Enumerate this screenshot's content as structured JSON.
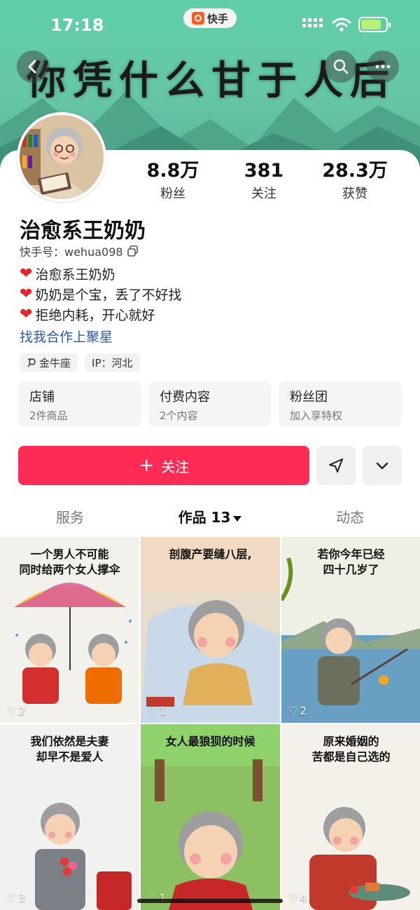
{
  "status": {
    "time": "17:18",
    "app_badge": "快手"
  },
  "banner": {
    "title": "你凭什么甘于人后"
  },
  "profile": {
    "name": "治愈系王奶奶",
    "user_id": "快手号：wehua098",
    "stats": [
      {
        "value": "8.8万",
        "label": "粉丝"
      },
      {
        "value": "381",
        "label": "关注"
      },
      {
        "value": "28.3万",
        "label": "获赞"
      }
    ],
    "bio": [
      "治愈系王奶奶",
      "奶奶是个宝，丢了不好找",
      "拒绝内耗，开心就好"
    ],
    "coop_link": "找我合作上聚星",
    "tags": [
      {
        "icon": "zodiac-icon",
        "text": "金牛座"
      },
      {
        "text": "IP：河北"
      }
    ]
  },
  "features": [
    {
      "title": "店铺",
      "sub": "2件商品"
    },
    {
      "title": "付费内容",
      "sub": "2个内容"
    },
    {
      "title": "粉丝团",
      "sub": "加入享特权"
    }
  ],
  "actions": {
    "follow_label": "关注"
  },
  "tabs": [
    {
      "label": "服务"
    },
    {
      "label": "作品 13"
    },
    {
      "label": "动态"
    }
  ],
  "works": [
    {
      "caption": "一个男人不可能\n同时给两个女人撑伞",
      "likes": "2"
    },
    {
      "caption": "剖腹产要缝八层,",
      "likes": "1"
    },
    {
      "caption": "若你今年已经\n四十几岁了",
      "likes": "2"
    },
    {
      "caption": "我们依然是夫妻\n却早不是爱人",
      "likes": "3"
    },
    {
      "caption": "女人最狼狈的时候",
      "likes": "1"
    },
    {
      "caption": "原来婚姻的\n苦都是自己选的",
      "likes": "4"
    }
  ],
  "colors": {
    "accent": "#fe2c55",
    "link": "#2a5aa8",
    "banner": "#66c7a6"
  }
}
